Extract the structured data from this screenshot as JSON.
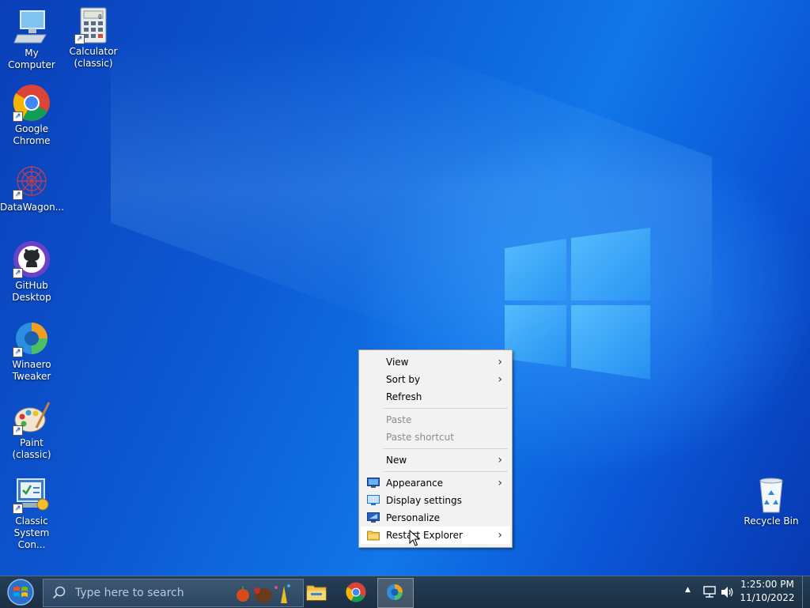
{
  "desktop": {
    "icons": [
      {
        "label": "My Computer"
      },
      {
        "label": "Calculator (classic)"
      },
      {
        "label": "Google Chrome"
      },
      {
        "label": "DataWagon..."
      },
      {
        "label": "GitHub Desktop"
      },
      {
        "label": "Winaero Tweaker"
      },
      {
        "label": "Paint (classic)"
      },
      {
        "label": "Classic System Con..."
      },
      {
        "label": "Recycle Bin"
      }
    ],
    "calculator_display": "0"
  },
  "context_menu": {
    "items": [
      {
        "label": "View",
        "submenu": true
      },
      {
        "label": "Sort by",
        "submenu": true
      },
      {
        "label": "Refresh"
      },
      {
        "label": "Paste",
        "disabled": true
      },
      {
        "label": "Paste shortcut",
        "disabled": true
      },
      {
        "label": "New",
        "submenu": true
      },
      {
        "label": "Appearance",
        "submenu": true,
        "icon": "appearance-icon"
      },
      {
        "label": "Display settings",
        "icon": "display-icon"
      },
      {
        "label": "Personalize",
        "icon": "personalize-icon"
      },
      {
        "label": "Restart Explorer",
        "submenu": true,
        "icon": "folder-icon",
        "hover": true
      }
    ],
    "submenu_glyph": "›"
  },
  "taskbar": {
    "search_placeholder": "Type here to search",
    "pinned": [
      "file-explorer-icon",
      "chrome-icon",
      "winaero-icon"
    ],
    "tray": {
      "overflow": "▲"
    },
    "clock": {
      "time": "1:25:00 PM",
      "date": "11/10/2022"
    }
  },
  "colors": {
    "desktop_blue": "#0c5ad4",
    "taskbar": "#1f3850",
    "menu_bg": "#f2f2f2",
    "disabled_text": "#8c8c8c"
  }
}
